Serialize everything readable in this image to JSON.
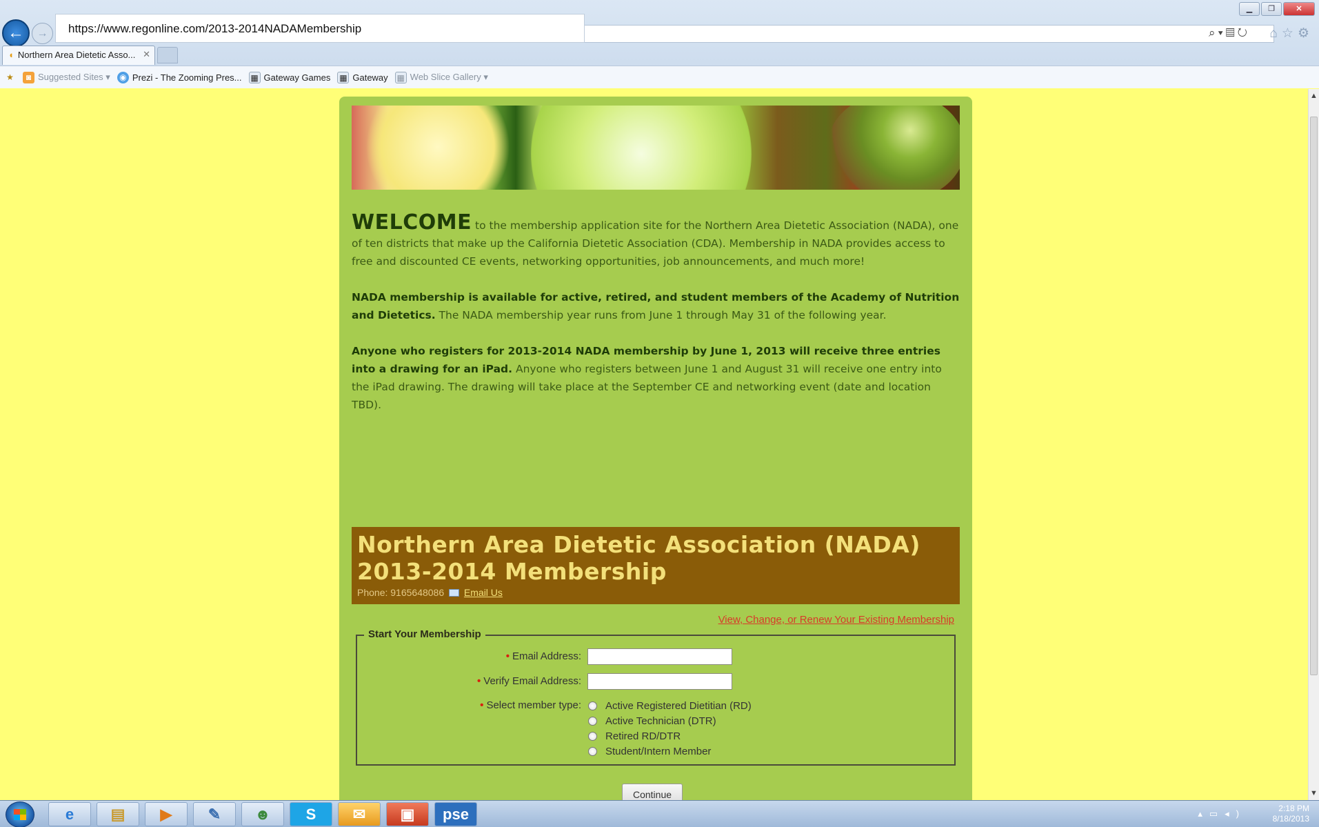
{
  "browser": {
    "url": "https://www.regonline.com/2013-2014NADAMembership",
    "tab_title": "Northern Area Dietetic Asso...",
    "favorites": [
      {
        "label": "Suggested Sites ▾",
        "icon": "rss-icon",
        "dim": true
      },
      {
        "label": "Prezi - The Zooming Pres...",
        "icon": "prezi-icon",
        "dim": false
      },
      {
        "label": "Gateway Games",
        "icon": "page-icon",
        "dim": false
      },
      {
        "label": "Gateway",
        "icon": "page-icon",
        "dim": false
      },
      {
        "label": "Web Slice Gallery ▾",
        "icon": "page-icon",
        "dim": true
      }
    ]
  },
  "intro": {
    "welcome": "WELCOME",
    "p1_rest": " to the membership application site for the Northern Area Dietetic Association (NADA), one of ten districts that make up the California Dietetic Association (CDA). Membership in NADA provides access to free and discounted CE events, networking opportunities, job announcements, and much more!",
    "p2_bold": "NADA membership is available for active, retired, and student members of the Academy of Nutrition and Dietetics.",
    "p2_rest": " The NADA membership year runs from June 1 through May 31 of the following year.",
    "p3_bold": "Anyone who registers for 2013-2014 NADA membership by June 1, 2013 will receive three entries into a drawing for an iPad.",
    "p3_rest": " Anyone who registers between June 1 and August 31 will receive one entry into the iPad drawing. The drawing will take place at the September CE and networking event (date and location TBD)."
  },
  "header": {
    "title_line1": "Northern Area Dietetic Association (NADA)",
    "title_line2": "2013-2014 Membership",
    "phone_label": "Phone: 9165648086",
    "email_link": "Email Us"
  },
  "renew_link": "View, Change, or Renew Your Existing Membership",
  "form": {
    "legend": "Start Your Membership",
    "email_label": "Email Address:",
    "verify_label": "Verify Email Address:",
    "member_type_label": "Select member type:",
    "member_types": [
      "Active Registered Dietitian (RD)",
      "Active Technician (DTR)",
      "Retired RD/DTR",
      "Student/Intern Member"
    ],
    "continue": "Continue"
  },
  "taskbar": {
    "time": "2:18 PM",
    "date": "8/18/2013",
    "apps": [
      "ie-icon",
      "explorer-icon",
      "media-player-icon",
      "paint-icon",
      "messenger-icon",
      "skype-icon",
      "outlook-icon",
      "photo-icon",
      "pse-icon"
    ],
    "pse_label": "pse"
  }
}
